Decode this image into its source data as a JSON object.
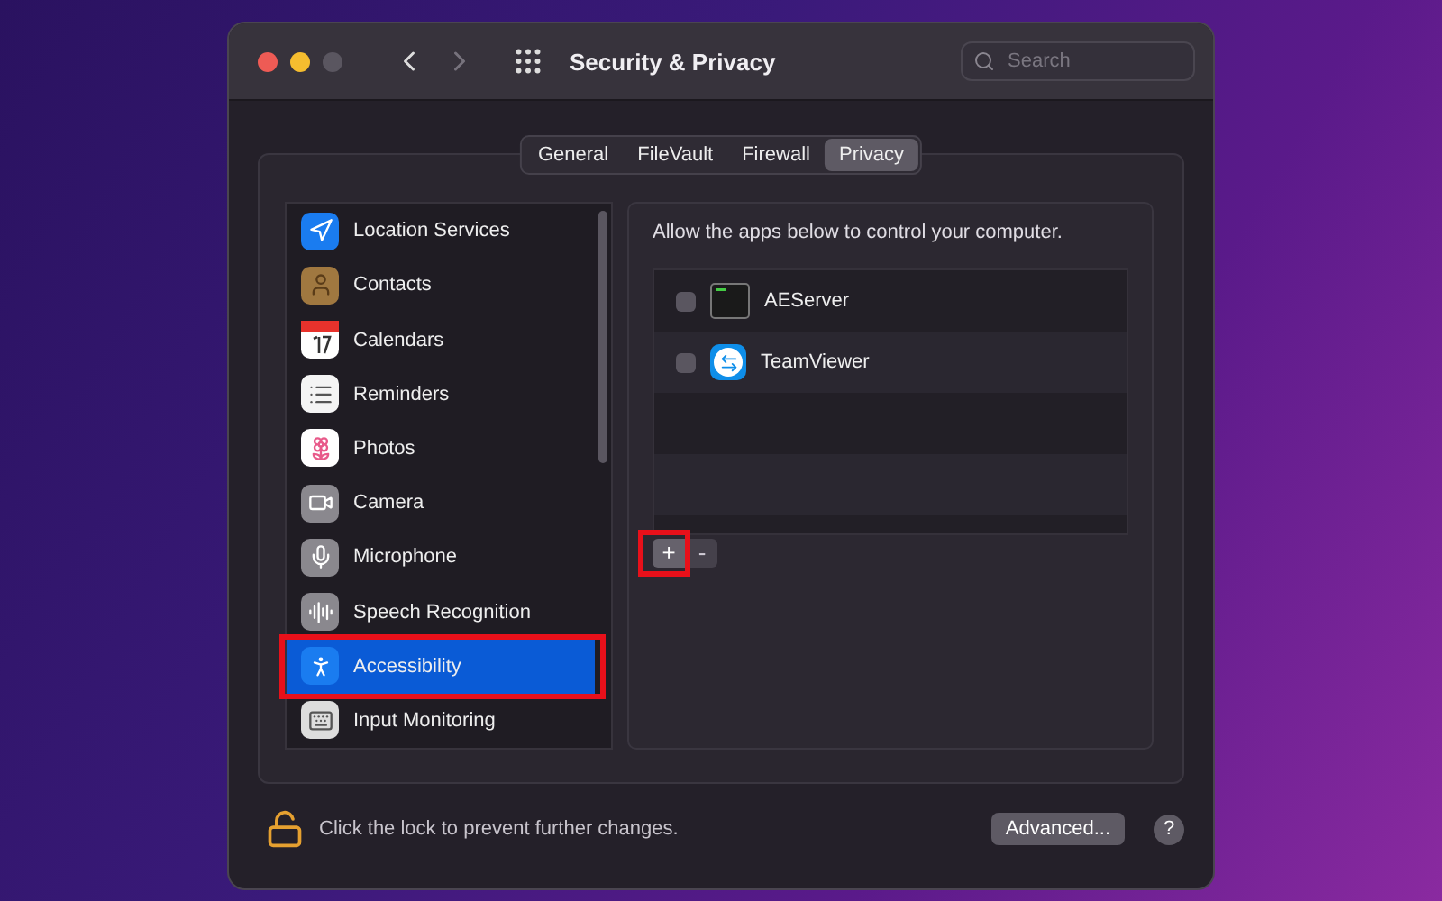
{
  "window": {
    "title": "Security & Privacy"
  },
  "search": {
    "placeholder": "Search"
  },
  "tabs": [
    {
      "label": "General",
      "selected": false
    },
    {
      "label": "FileVault",
      "selected": false
    },
    {
      "label": "Firewall",
      "selected": false
    },
    {
      "label": "Privacy",
      "selected": true
    }
  ],
  "sidebar": {
    "items": [
      {
        "label": "Location Services",
        "selected": false,
        "annotated": false
      },
      {
        "label": "Contacts",
        "selected": false,
        "annotated": false
      },
      {
        "label": "Calendars",
        "selected": false,
        "annotated": false
      },
      {
        "label": "Reminders",
        "selected": false,
        "annotated": false
      },
      {
        "label": "Photos",
        "selected": false,
        "annotated": false
      },
      {
        "label": "Camera",
        "selected": false,
        "annotated": false
      },
      {
        "label": "Microphone",
        "selected": false,
        "annotated": false
      },
      {
        "label": "Speech Recognition",
        "selected": false,
        "annotated": false
      },
      {
        "label": "Accessibility",
        "selected": true,
        "annotated": true
      },
      {
        "label": "Input Monitoring",
        "selected": false,
        "annotated": false
      }
    ]
  },
  "detail": {
    "description": "Allow the apps below to control your computer.",
    "apps": [
      {
        "name": "AEServer",
        "checked": false
      },
      {
        "name": "TeamViewer",
        "checked": false
      }
    ],
    "add_button": {
      "label": "+",
      "annotated": true
    },
    "remove_button": {
      "label": "-",
      "disabled": true
    }
  },
  "footer": {
    "lock_text": "Click the lock to prevent further changes.",
    "advanced_button": "Advanced...",
    "help_button": "?"
  }
}
